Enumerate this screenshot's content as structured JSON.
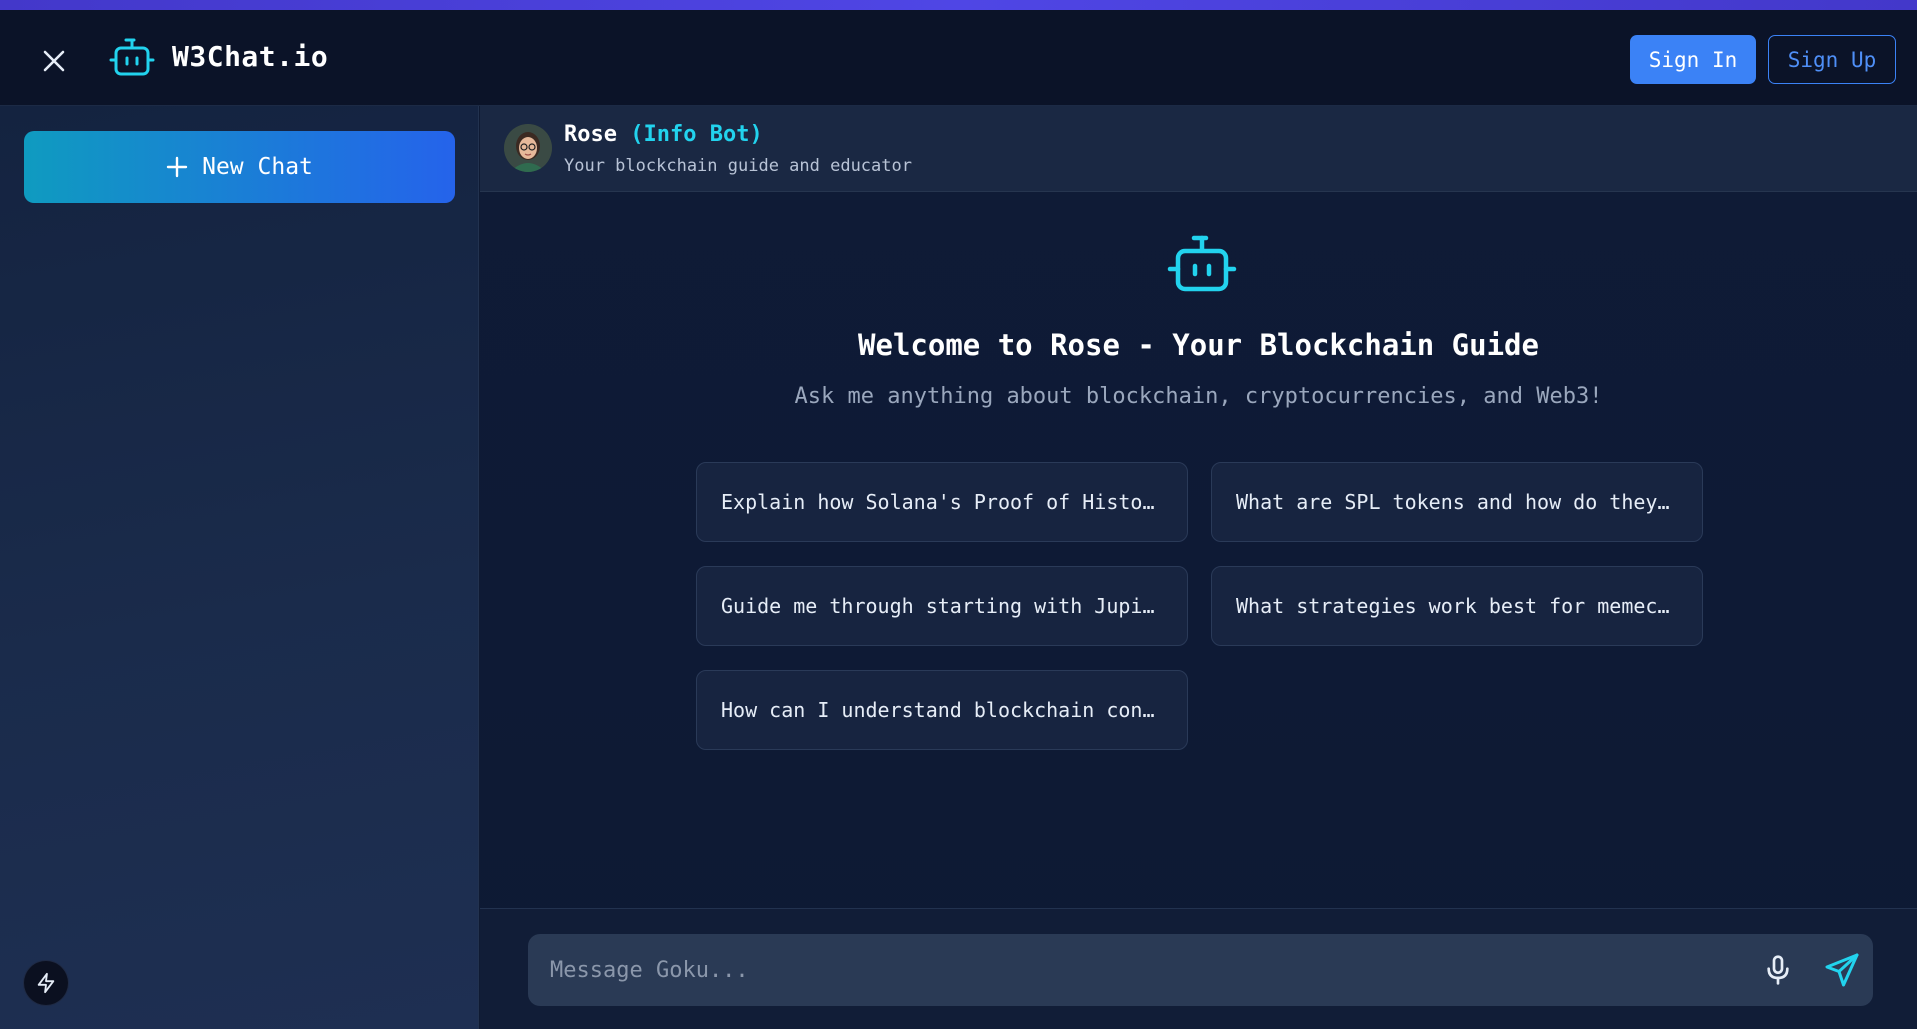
{
  "header": {
    "brand": "W3Chat.io",
    "sign_in": "Sign In",
    "sign_up": "Sign Up"
  },
  "sidebar": {
    "new_chat": "New Chat"
  },
  "bot": {
    "name": "Rose",
    "tag": "(Info Bot)",
    "subtitle": "Your blockchain guide and educator"
  },
  "welcome": {
    "title": "Welcome to Rose - Your Blockchain Guide",
    "subtitle": "Ask me anything about blockchain, cryptocurrencies, and Web3!"
  },
  "suggestions": [
    "Explain how Solana's Proof of History works",
    "What are SPL tokens and how do they work?",
    "Guide me through starting with Jupiter",
    "What strategies work best for memecoins?",
    "How can I understand blockchain concepts?"
  ],
  "composer": {
    "placeholder": "Message Goku..."
  },
  "colors": {
    "accent": "#3b82f6",
    "cyan": "#22d3ee",
    "background": "#0f1a33"
  }
}
